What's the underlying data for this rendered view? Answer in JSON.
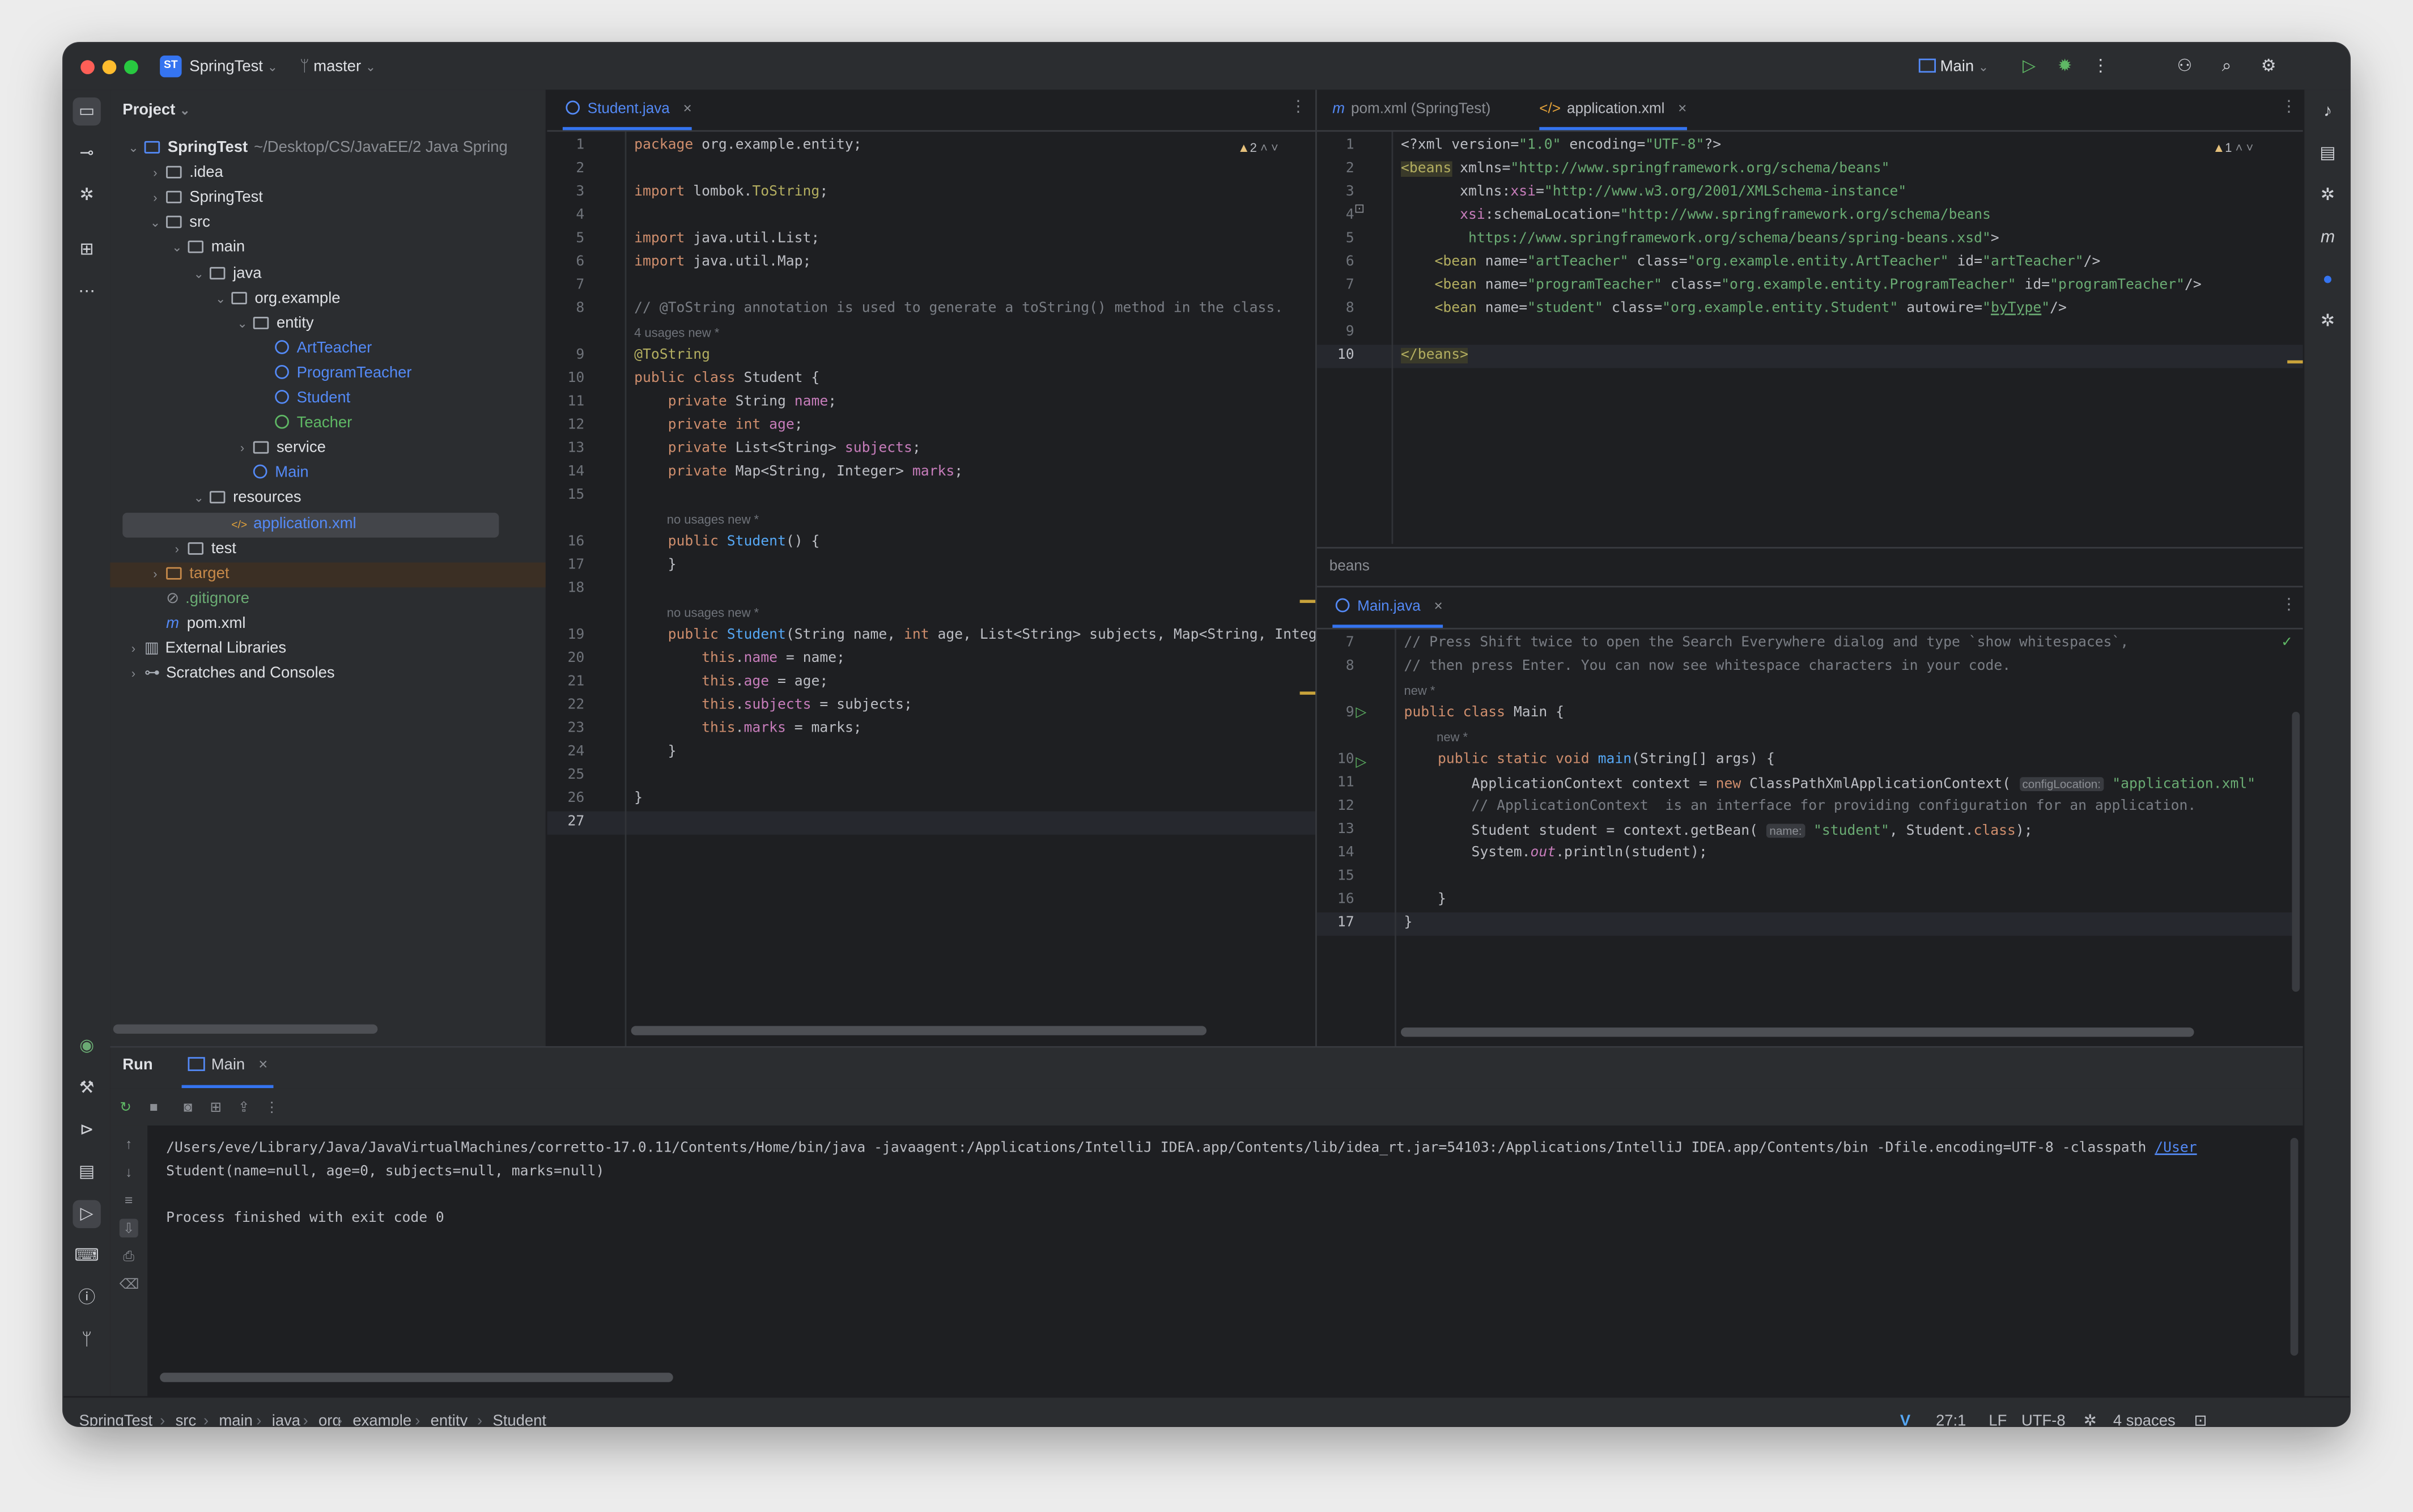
{
  "titlebar": {
    "project_badge": "ST",
    "project_name": "SpringTest",
    "branch": "master",
    "run_config": "Main"
  },
  "project_panel": {
    "header": "Project",
    "tree": [
      {
        "label": "SpringTest",
        "extra": "~/Desktop/CS/JavaEE/2 Java Spring",
        "depth": 0,
        "type": "module",
        "arrow": "down"
      },
      {
        "label": ".idea",
        "depth": 1,
        "type": "folder",
        "arrow": "right"
      },
      {
        "label": "SpringTest",
        "depth": 1,
        "type": "folder",
        "arrow": "right"
      },
      {
        "label": "src",
        "depth": 1,
        "type": "folder",
        "arrow": "down"
      },
      {
        "label": "main",
        "depth": 2,
        "type": "folder",
        "arrow": "down"
      },
      {
        "label": "java",
        "depth": 3,
        "type": "folder",
        "arrow": "down"
      },
      {
        "label": "org.example",
        "depth": 4,
        "type": "folder",
        "arrow": "down"
      },
      {
        "label": "entity",
        "depth": 5,
        "type": "folder",
        "arrow": "down"
      },
      {
        "label": "ArtTeacher",
        "depth": 6,
        "type": "class"
      },
      {
        "label": "ProgramTeacher",
        "depth": 6,
        "type": "class"
      },
      {
        "label": "Student",
        "depth": 6,
        "type": "class"
      },
      {
        "label": "Teacher",
        "depth": 6,
        "type": "interface"
      },
      {
        "label": "service",
        "depth": 5,
        "type": "folder",
        "arrow": "right"
      },
      {
        "label": "Main",
        "depth": 5,
        "type": "class"
      },
      {
        "label": "resources",
        "depth": 3,
        "type": "folder",
        "arrow": "down"
      },
      {
        "label": "application.xml",
        "depth": 4,
        "type": "xml",
        "selected": true
      },
      {
        "label": "test",
        "depth": 2,
        "type": "folder",
        "arrow": "right"
      },
      {
        "label": "target",
        "depth": 1,
        "type": "excluded",
        "arrow": "right"
      },
      {
        "label": ".gitignore",
        "depth": 1,
        "type": "ignore"
      },
      {
        "label": "pom.xml",
        "depth": 1,
        "type": "maven"
      },
      {
        "label": "External Libraries",
        "depth": 0,
        "type": "lib",
        "arrow": "right"
      },
      {
        "label": "Scratches and Consoles",
        "depth": 0,
        "type": "scratch",
        "arrow": "right"
      }
    ]
  },
  "editor_left": {
    "tab": "Student.java",
    "warnings": "2",
    "lines": [
      {
        "n": "1",
        "html": "<span class='kw'>package</span> org.example.entity;"
      },
      {
        "n": "2",
        "html": ""
      },
      {
        "n": "3",
        "html": "<span class='kw'>import</span> lombok.<span class='ann'>ToString</span>;"
      },
      {
        "n": "4",
        "html": ""
      },
      {
        "n": "5",
        "html": "<span class='kw'>import</span> java.util.List;"
      },
      {
        "n": "6",
        "html": "<span class='kw'>import</span> java.util.Map;"
      },
      {
        "n": "7",
        "html": ""
      },
      {
        "n": "8",
        "html": "<span class='com'>// @ToString annotation is used to generate a toString() method in the class.</span>"
      },
      {
        "hint": "4 usages   new *"
      },
      {
        "n": "9",
        "html": "<span class='ann'>@ToString</span>"
      },
      {
        "n": "10",
        "html": "<span class='kw'>public class</span> Student {"
      },
      {
        "n": "11",
        "html": "    <span class='kw'>private</span> String <span class='fld'>name</span>;"
      },
      {
        "n": "12",
        "html": "    <span class='kw'>private int</span> <span class='fld'>age</span>;"
      },
      {
        "n": "13",
        "html": "    <span class='kw'>private</span> List&lt;String&gt; <span class='fld'>subjects</span>;"
      },
      {
        "n": "14",
        "html": "    <span class='kw'>private</span> Map&lt;String, Integer&gt; <span class='fld'>marks</span>;"
      },
      {
        "n": "15",
        "html": ""
      },
      {
        "hint": "no usages   new *"
      },
      {
        "n": "16",
        "html": "    <span class='kw'>public</span> <span class='fn'>Student</span>() {"
      },
      {
        "n": "17",
        "html": "    }"
      },
      {
        "n": "18",
        "html": ""
      },
      {
        "hint": "no usages   new *"
      },
      {
        "n": "19",
        "html": "    <span class='kw'>public</span> <span class='fn'>Student</span>(String name, <span class='kw'>int</span> age, List&lt;String&gt; subjects, Map&lt;String, Intege"
      },
      {
        "n": "20",
        "html": "        <span class='kw'>this</span>.<span class='fld'>name</span> = name;"
      },
      {
        "n": "21",
        "html": "        <span class='kw'>this</span>.<span class='fld'>age</span> = age;"
      },
      {
        "n": "22",
        "html": "        <span class='kw'>this</span>.<span class='fld'>subjects</span> = subjects;"
      },
      {
        "n": "23",
        "html": "        <span class='kw'>this</span>.<span class='fld'>marks</span> = marks;"
      },
      {
        "n": "24",
        "html": "    }"
      },
      {
        "n": "25",
        "html": ""
      },
      {
        "n": "26",
        "html": "}"
      },
      {
        "n": "27",
        "html": "",
        "current": true
      }
    ]
  },
  "editor_right_top": {
    "tabs": [
      "pom.xml (SpringTest)",
      "application.xml"
    ],
    "warnings": "1",
    "breadcrumb": "beans",
    "lines": [
      {
        "n": "1",
        "html": "&lt;?xml version=<span class='str'>\"1.0\"</span> encoding=<span class='str'>\"UTF-8\"</span>?&gt;"
      },
      {
        "n": "2",
        "html": "<span class='ann' style='background:#3a3a2a'>&lt;beans</span> xmlns=<span class='str'>\"http://www.springframework.org/schema/beans\"</span>"
      },
      {
        "n": "3",
        "html": "       xmlns:<span class='fld'>xsi</span>=<span class='str'>\"http://www.w3.org/2001/XMLSchema-instance\"</span>"
      },
      {
        "n": "4",
        "html": "       <span class='fld'>xsi</span>:schemaLocation=<span class='str'>\"http://www.springframework.org/schema/beans</span>"
      },
      {
        "n": "5",
        "html": "<span class='str'>        https://www.springframework.org/schema/beans/spring-beans.xsd\"</span>&gt;"
      },
      {
        "n": "6",
        "html": "    <span class='ann'>&lt;bean</span> name=<span class='str'>\"artTeacher\"</span> class=<span class='str'>\"org.example.entity.ArtTeacher\"</span> id=<span class='str'>\"artTeacher\"</span>/&gt;"
      },
      {
        "n": "7",
        "html": "    <span class='ann'>&lt;bean</span> name=<span class='str'>\"programTeacher\"</span> class=<span class='str'>\"org.example.entity.ProgramTeacher\"</span> id=<span class='str'>\"programTeacher\"</span>/&gt;"
      },
      {
        "n": "8",
        "html": "    <span class='ann'>&lt;bean</span> name=<span class='str'>\"student\"</span> class=<span class='str'>\"org.example.entity.Student\"</span> autowire=<span class='str'>\"<u>byType</u>\"</span>/&gt;"
      },
      {
        "n": "9",
        "html": ""
      },
      {
        "n": "10",
        "html": "<span class='ann' style='background:#3a3a2a'>&lt;/beans&gt;</span>",
        "current": true
      }
    ]
  },
  "editor_right_bottom": {
    "tab": "Main.java",
    "lines": [
      {
        "n": "7",
        "html": "<span class='com'>// Press Shift twice to open the Search Everywhere dialog and type `show whitespaces`,</span>"
      },
      {
        "n": "8",
        "html": "<span class='com'>// then press Enter. You can now see whitespace characters in your code.</span>"
      },
      {
        "hint": "new *"
      },
      {
        "n": "9",
        "html": "<span class='kw'>public class</span> Main {"
      },
      {
        "hint2": "new *"
      },
      {
        "n": "10",
        "html": "    <span class='kw'>public static void</span> <span class='fn'>main</span>(String[] args) {"
      },
      {
        "n": "11",
        "html": "        ApplicationContext context = <span class='kw'>new</span> ClassPathXmlApplicationContext( <span class='inl'>configLocation:</span> <span class='str'>\"application.xml\"</span>"
      },
      {
        "n": "12",
        "html": "        <span class='com'>// ApplicationContext  is an interface for providing configuration for an application.</span>"
      },
      {
        "n": "13",
        "html": "        Student student = context.getBean( <span class='inl'>name:</span> <span class='str'>\"student\"</span>, Student.<span class='kw'>class</span>);"
      },
      {
        "n": "14",
        "html": "        System.<span class='fld'><i>out</i></span>.println(student);"
      },
      {
        "n": "15",
        "html": ""
      },
      {
        "n": "16",
        "html": "    }"
      },
      {
        "n": "17",
        "html": "}",
        "current": true
      }
    ]
  },
  "run_panel": {
    "title": "Run",
    "tab": "Main",
    "output": [
      "/Users/eve/Library/Java/JavaVirtualMachines/corretto-17.0.11/Contents/Home/bin/java -javaagent:/Applications/IntelliJ IDEA.app/Contents/lib/idea_rt.jar=54103:/Applications/IntelliJ IDEA.app/Contents/bin -Dfile.encoding=UTF-8 -classpath ",
      "Student(name=null, age=0, subjects=null, marks=null)",
      "",
      "Process finished with exit code 0"
    ],
    "output_link": "/User"
  },
  "statusbar": {
    "crumbs": [
      "SpringTest",
      "src",
      "main",
      "java",
      "org",
      "example",
      "entity",
      "Student"
    ],
    "position": "27:1",
    "line_sep": "LF",
    "encoding": "UTF-8",
    "indent": "4 spaces"
  },
  "colors": {
    "accent": "#3574f0",
    "keyword": "#cf8e6d",
    "string": "#6aab73",
    "field": "#c77dbb"
  }
}
